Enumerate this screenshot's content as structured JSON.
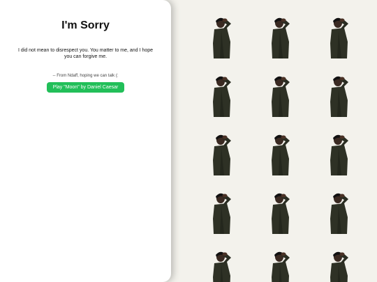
{
  "card": {
    "title": "I'm Sorry",
    "message": "I did not mean to disrespect you. You matter to me, and I hope you can forgive me.",
    "signature": "-- From Ndaff, hoping we can talk (:",
    "play_button_label": "Play \"Moon\" by Daniel Caesar"
  },
  "background": {
    "pattern_image": "man-in-dark-coat-hand-on-head-photo",
    "tile_count": 15
  },
  "colors": {
    "page_background": "#f3f2ec",
    "card_background": "#ffffff",
    "button": "#22bf59",
    "button_text": "#ffffff"
  }
}
